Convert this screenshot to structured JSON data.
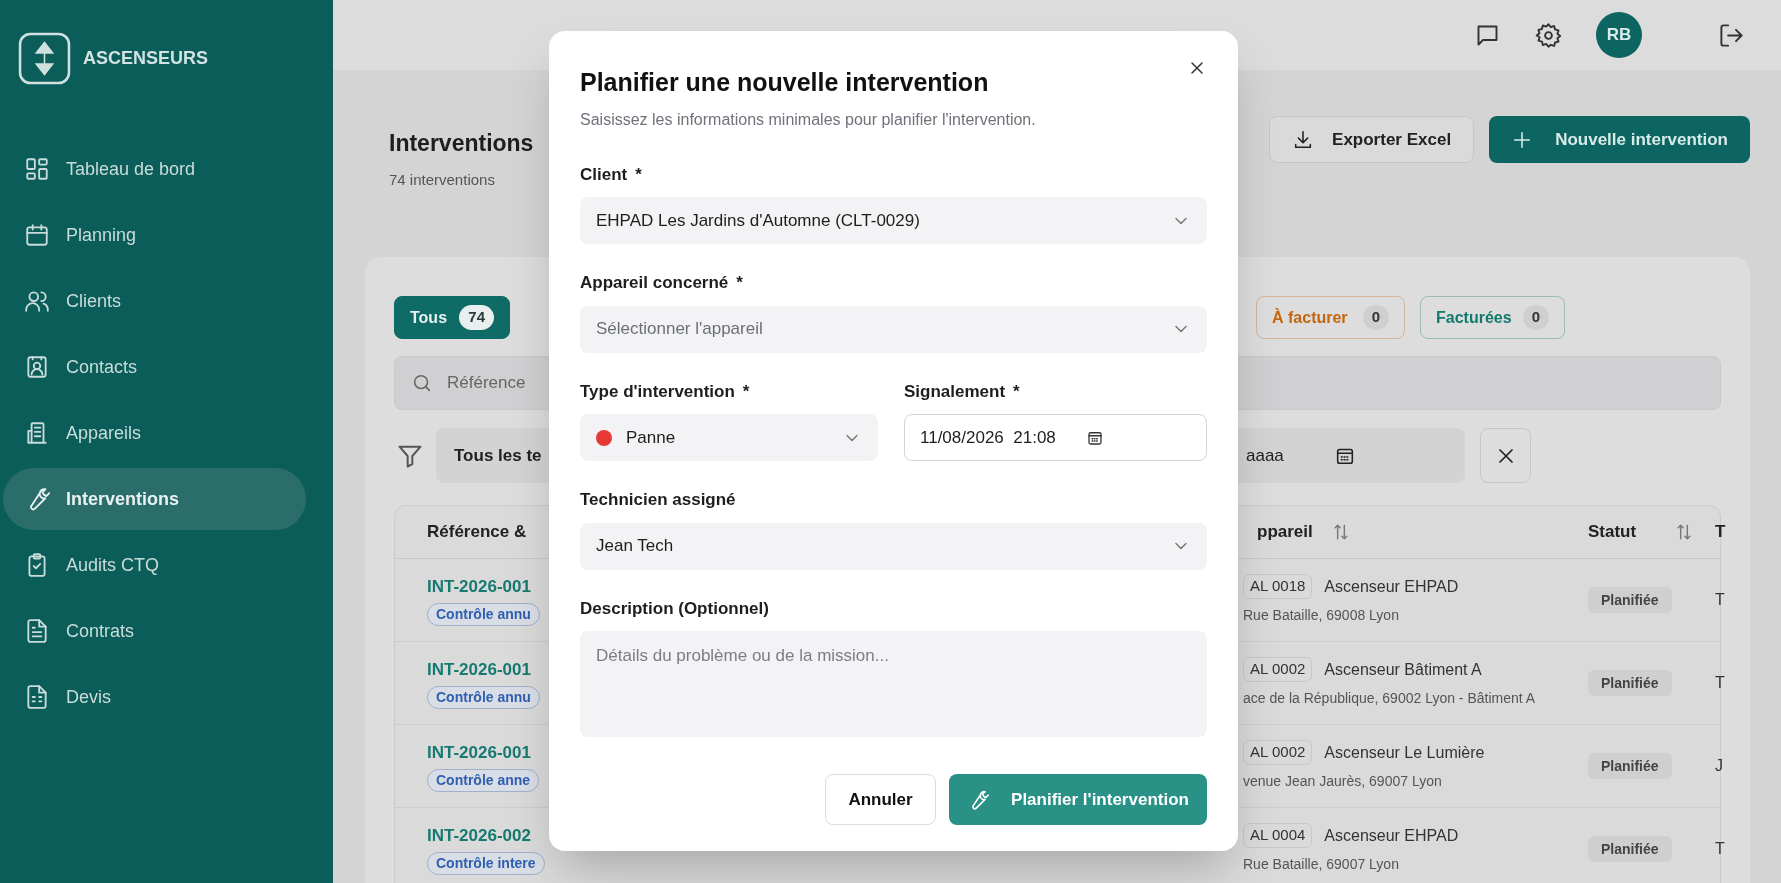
{
  "brand": {
    "name": "ASCENSEURS"
  },
  "sidebar": {
    "items": [
      {
        "label": "Tableau de bord",
        "selected": false
      },
      {
        "label": "Planning",
        "selected": false
      },
      {
        "label": "Clients",
        "selected": false
      },
      {
        "label": "Contacts",
        "selected": false
      },
      {
        "label": "Appareils",
        "selected": false
      },
      {
        "label": "Interventions",
        "selected": true
      },
      {
        "label": "Audits CTQ",
        "selected": false
      },
      {
        "label": "Contrats",
        "selected": false
      },
      {
        "label": "Devis",
        "selected": false
      }
    ]
  },
  "topbar": {
    "avatar_initials": "RB"
  },
  "page": {
    "title": "Interventions",
    "subtitle": "74 interventions",
    "export_button": "Exporter Excel",
    "new_button": "Nouvelle intervention"
  },
  "status_tabs": [
    {
      "label": "Tous",
      "count": "74",
      "selected": true,
      "color": "#0e6b65"
    },
    {
      "label": "À facturer",
      "count": "0",
      "selected": false,
      "color": "#c2670f"
    },
    {
      "label": "Facturées",
      "count": "0",
      "selected": false,
      "color": "#137a6e"
    }
  ],
  "search": {
    "placeholder": "Référence"
  },
  "filters": {
    "territory": "Tous les te",
    "date_placeholder": "aaaa"
  },
  "table": {
    "columns": [
      "Référence &",
      "ppareil",
      "Statut",
      "T"
    ],
    "rows": [
      {
        "reference": "INT-2026-001",
        "tag": "Contrôle annu",
        "device_code": "AL 0018",
        "device_name": "Ascenseur EHPAD",
        "address": "Rue Bataille, 69008 Lyon",
        "status": "Planifiée",
        "column_4": "T"
      },
      {
        "reference": "INT-2026-001",
        "tag": "Contrôle annu",
        "device_code": "AL 0002",
        "device_name": "Ascenseur Bâtiment A",
        "address": "ace de la République, 69002 Lyon - Bâtiment A",
        "status": "Planifiée",
        "column_4": "T"
      },
      {
        "reference": "INT-2026-001",
        "tag": "Contrôle anne",
        "device_code": "AL 0002",
        "device_name": "Ascenseur Le Lumière",
        "address": "venue Jean Jaurès, 69007 Lyon",
        "status": "Planifiée",
        "column_4": "J"
      },
      {
        "reference": "INT-2026-002",
        "tag": "Contrôle intere",
        "device_code": "AL 0004",
        "device_name": "Ascenseur EHPAD",
        "address": "Rue Bataille, 69007 Lyon",
        "status": "Planifiée",
        "column_4": "T"
      }
    ]
  },
  "modal": {
    "title": "Planifier une nouvelle intervention",
    "subtitle": "Saisissez les informations minimales pour planifier l'intervention.",
    "fields": [
      {
        "kind": "select",
        "label": "Client",
        "required_mark": "*",
        "value": "EHPAD Les Jardins d'Automne (CLT-0029)"
      },
      {
        "kind": "select",
        "label": "Appareil concerné",
        "required_mark": "*",
        "placeholder": "Sélectionner l'appareil"
      },
      {
        "kind": "pair",
        "items": [
          {
            "kind": "select",
            "label": "Type d'intervention",
            "required_mark": "*",
            "value": "Panne",
            "color": "#e53935"
          },
          {
            "kind": "datetime",
            "label": "Signalement",
            "required_mark": "*",
            "value": "11/08/2026  21:08"
          }
        ]
      },
      {
        "kind": "select",
        "label": "Technicien assigné",
        "value": "Jean Tech"
      },
      {
        "kind": "textarea",
        "label": "Description (Optionnel)",
        "placeholder": "Détails du problème ou de la mission..."
      }
    ],
    "cancel_button": "Annuler",
    "submit_button": "Planifier l'intervention"
  }
}
